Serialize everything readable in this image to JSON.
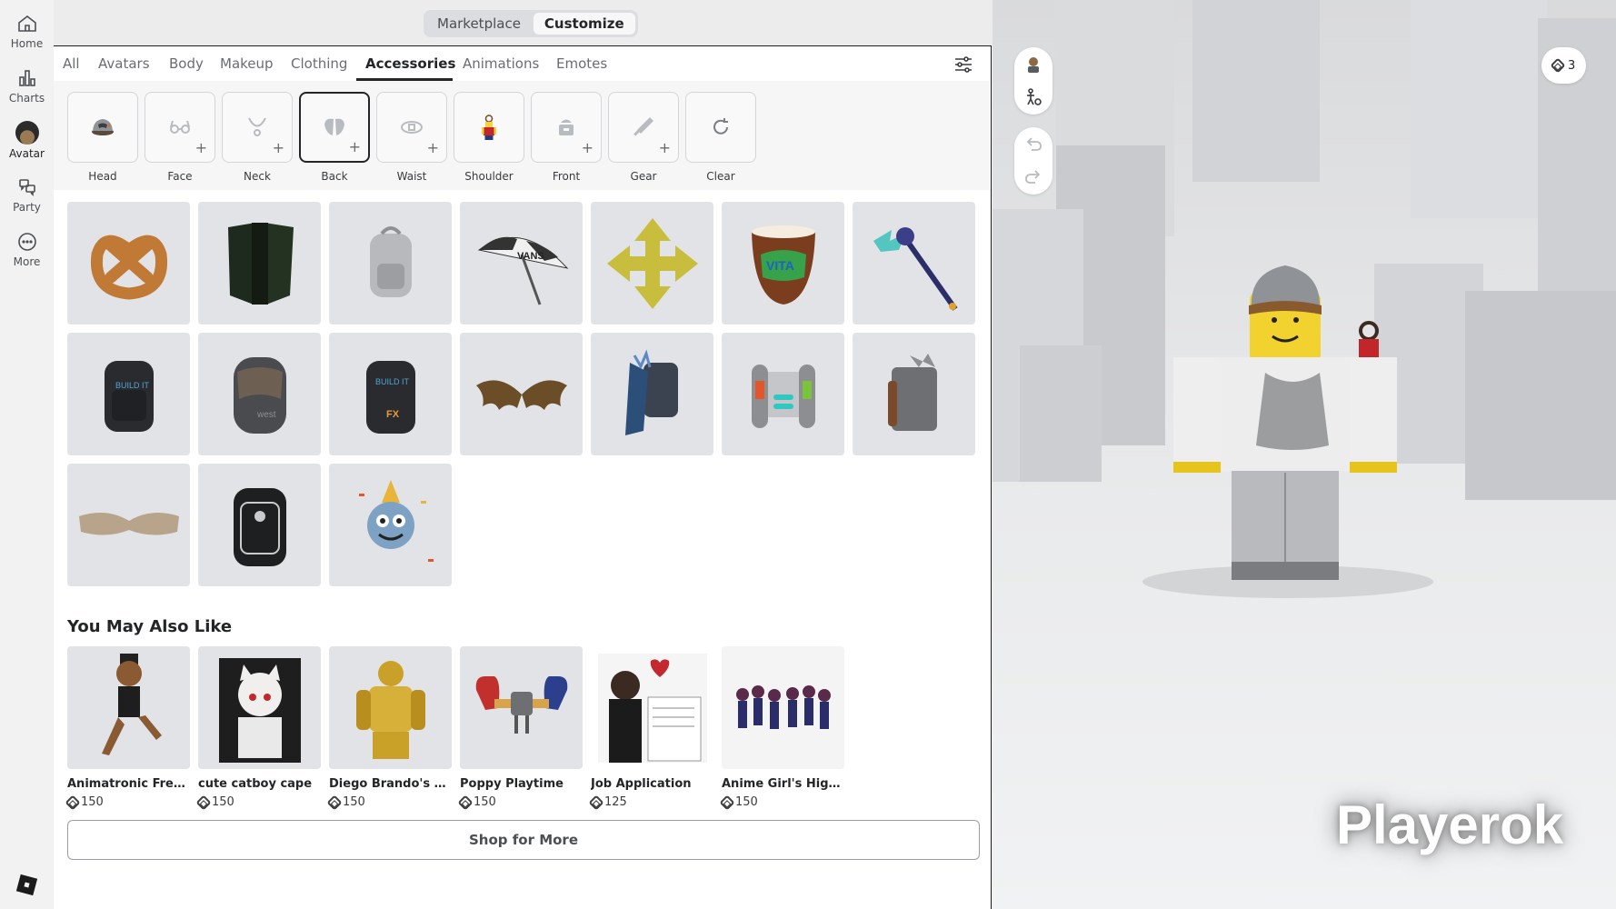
{
  "nav": {
    "items": [
      {
        "label": "Home",
        "icon": "home-icon"
      },
      {
        "label": "Charts",
        "icon": "charts-icon"
      },
      {
        "label": "Avatar",
        "icon": "avatar-icon"
      },
      {
        "label": "Party",
        "icon": "party-icon"
      },
      {
        "label": "More",
        "icon": "more-icon"
      }
    ],
    "active": "Avatar"
  },
  "mode_toggle": {
    "marketplace": "Marketplace",
    "customize": "Customize",
    "active": "Customize"
  },
  "tabs": [
    "All",
    "Avatars",
    "Body",
    "Makeup",
    "Clothing",
    "Accessories",
    "Animations",
    "Emotes"
  ],
  "active_tab": "Accessories",
  "categories": [
    "Head",
    "Face",
    "Neck",
    "Back",
    "Waist",
    "Shoulder",
    "Front",
    "Gear",
    "Clear"
  ],
  "active_category": "Back",
  "items": [
    "pretzel-icon",
    "dark-wings-icon",
    "silver-backpack-icon",
    "vans-umbrella-icon",
    "gold-arrows-icon",
    "vita-coco-icon",
    "crystal-staff-icon",
    "black-backpack-icon",
    "grey-backpack-icon",
    "fx-artist-backpack-icon",
    "bat-wings-icon",
    "dragon-backpack-icon",
    "jetpack-icon",
    "brown-backpack-icon",
    "sand-wings-icon",
    "jurassic-backpack-icon",
    "party-mascot-icon"
  ],
  "you_may_also_like": {
    "title": "You May Also Like",
    "items": [
      {
        "name": "Animatronic Fredd...",
        "price": "150"
      },
      {
        "name": "cute catboy cape",
        "price": "150"
      },
      {
        "name": "Diego Brando's THE",
        "price": "150"
      },
      {
        "name": "Poppy Playtime",
        "price": "150"
      },
      {
        "name": "Job Application",
        "price": "125"
      },
      {
        "name": "Anime Girl's Highsc...",
        "price": "150"
      }
    ]
  },
  "shop_more": "Shop for More",
  "viewport": {
    "robux_balance": "3",
    "username": "Playerok"
  },
  "colors": {
    "accent": "#232527",
    "panel": "#ffffff",
    "tile": "#e2e3e6"
  }
}
